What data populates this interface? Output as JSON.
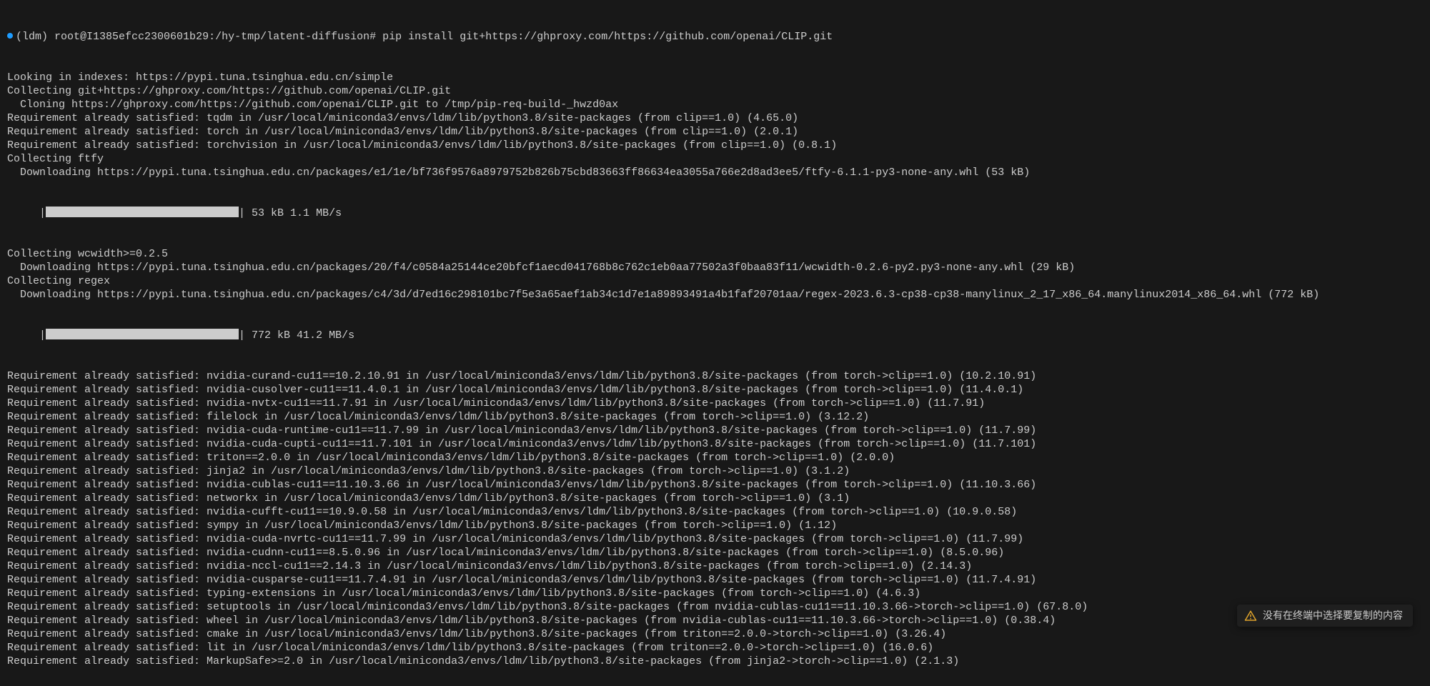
{
  "prompt": {
    "env": "(ldm)",
    "userhost": "root@I1385efcc2300601b29",
    "path": "/hy-tmp/latent-diffusion",
    "sep": "#",
    "command": "pip install git+https://ghproxy.com/https://github.com/openai/CLIP.git"
  },
  "lines": [
    "Looking in indexes: https://pypi.tuna.tsinghua.edu.cn/simple",
    "Collecting git+https://ghproxy.com/https://github.com/openai/CLIP.git",
    "  Cloning https://ghproxy.com/https://github.com/openai/CLIP.git to /tmp/pip-req-build-_hwzd0ax",
    "Requirement already satisfied: tqdm in /usr/local/miniconda3/envs/ldm/lib/python3.8/site-packages (from clip==1.0) (4.65.0)",
    "Requirement already satisfied: torch in /usr/local/miniconda3/envs/ldm/lib/python3.8/site-packages (from clip==1.0) (2.0.1)",
    "Requirement already satisfied: torchvision in /usr/local/miniconda3/envs/ldm/lib/python3.8/site-packages (from clip==1.0) (0.8.1)",
    "Collecting ftfy",
    "  Downloading https://pypi.tuna.tsinghua.edu.cn/packages/e1/1e/bf736f9576a8979752b826b75cbd83663ff86634ea3055a766e2d8ad3ee5/ftfy-6.1.1-py3-none-any.whl (53 kB)"
  ],
  "progress1_tail": " 53 kB 1.1 MB/s",
  "lines2": [
    "Collecting wcwidth>=0.2.5",
    "  Downloading https://pypi.tuna.tsinghua.edu.cn/packages/20/f4/c0584a25144ce20bfcf1aecd041768b8c762c1eb0aa77502a3f0baa83f11/wcwidth-0.2.6-py2.py3-none-any.whl (29 kB)",
    "Collecting regex",
    "  Downloading https://pypi.tuna.tsinghua.edu.cn/packages/c4/3d/d7ed16c298101bc7f5e3a65aef1ab34c1d7e1a89893491a4b1faf20701aa/regex-2023.6.3-cp38-cp38-manylinux_2_17_x86_64.manylinux2014_x86_64.whl (772 kB)"
  ],
  "progress2_tail": " 772 kB 41.2 MB/s",
  "lines3": [
    "Requirement already satisfied: nvidia-curand-cu11==10.2.10.91 in /usr/local/miniconda3/envs/ldm/lib/python3.8/site-packages (from torch->clip==1.0) (10.2.10.91)",
    "Requirement already satisfied: nvidia-cusolver-cu11==11.4.0.1 in /usr/local/miniconda3/envs/ldm/lib/python3.8/site-packages (from torch->clip==1.0) (11.4.0.1)",
    "Requirement already satisfied: nvidia-nvtx-cu11==11.7.91 in /usr/local/miniconda3/envs/ldm/lib/python3.8/site-packages (from torch->clip==1.0) (11.7.91)",
    "Requirement already satisfied: filelock in /usr/local/miniconda3/envs/ldm/lib/python3.8/site-packages (from torch->clip==1.0) (3.12.2)",
    "Requirement already satisfied: nvidia-cuda-runtime-cu11==11.7.99 in /usr/local/miniconda3/envs/ldm/lib/python3.8/site-packages (from torch->clip==1.0) (11.7.99)",
    "Requirement already satisfied: nvidia-cuda-cupti-cu11==11.7.101 in /usr/local/miniconda3/envs/ldm/lib/python3.8/site-packages (from torch->clip==1.0) (11.7.101)",
    "Requirement already satisfied: triton==2.0.0 in /usr/local/miniconda3/envs/ldm/lib/python3.8/site-packages (from torch->clip==1.0) (2.0.0)",
    "Requirement already satisfied: jinja2 in /usr/local/miniconda3/envs/ldm/lib/python3.8/site-packages (from torch->clip==1.0) (3.1.2)",
    "Requirement already satisfied: nvidia-cublas-cu11==11.10.3.66 in /usr/local/miniconda3/envs/ldm/lib/python3.8/site-packages (from torch->clip==1.0) (11.10.3.66)",
    "Requirement already satisfied: networkx in /usr/local/miniconda3/envs/ldm/lib/python3.8/site-packages (from torch->clip==1.0) (3.1)",
    "Requirement already satisfied: nvidia-cufft-cu11==10.9.0.58 in /usr/local/miniconda3/envs/ldm/lib/python3.8/site-packages (from torch->clip==1.0) (10.9.0.58)",
    "Requirement already satisfied: sympy in /usr/local/miniconda3/envs/ldm/lib/python3.8/site-packages (from torch->clip==1.0) (1.12)",
    "Requirement already satisfied: nvidia-cuda-nvrtc-cu11==11.7.99 in /usr/local/miniconda3/envs/ldm/lib/python3.8/site-packages (from torch->clip==1.0) (11.7.99)",
    "Requirement already satisfied: nvidia-cudnn-cu11==8.5.0.96 in /usr/local/miniconda3/envs/ldm/lib/python3.8/site-packages (from torch->clip==1.0) (8.5.0.96)",
    "Requirement already satisfied: nvidia-nccl-cu11==2.14.3 in /usr/local/miniconda3/envs/ldm/lib/python3.8/site-packages (from torch->clip==1.0) (2.14.3)",
    "Requirement already satisfied: nvidia-cusparse-cu11==11.7.4.91 in /usr/local/miniconda3/envs/ldm/lib/python3.8/site-packages (from torch->clip==1.0) (11.7.4.91)",
    "Requirement already satisfied: typing-extensions in /usr/local/miniconda3/envs/ldm/lib/python3.8/site-packages (from torch->clip==1.0) (4.6.3)",
    "Requirement already satisfied: setuptools in /usr/local/miniconda3/envs/ldm/lib/python3.8/site-packages (from nvidia-cublas-cu11==11.10.3.66->torch->clip==1.0) (67.8.0)",
    "Requirement already satisfied: wheel in /usr/local/miniconda3/envs/ldm/lib/python3.8/site-packages (from nvidia-cublas-cu11==11.10.3.66->torch->clip==1.0) (0.38.4)",
    "Requirement already satisfied: cmake in /usr/local/miniconda3/envs/ldm/lib/python3.8/site-packages (from triton==2.0.0->torch->clip==1.0) (3.26.4)",
    "Requirement already satisfied: lit in /usr/local/miniconda3/envs/ldm/lib/python3.8/site-packages (from triton==2.0.0->torch->clip==1.0) (16.0.6)",
    "Requirement already satisfied: MarkupSafe>=2.0 in /usr/local/miniconda3/envs/ldm/lib/python3.8/site-packages (from jinja2->torch->clip==1.0) (2.1.3)"
  ],
  "toast": {
    "text": "没有在终端中选择要复制的内容"
  }
}
